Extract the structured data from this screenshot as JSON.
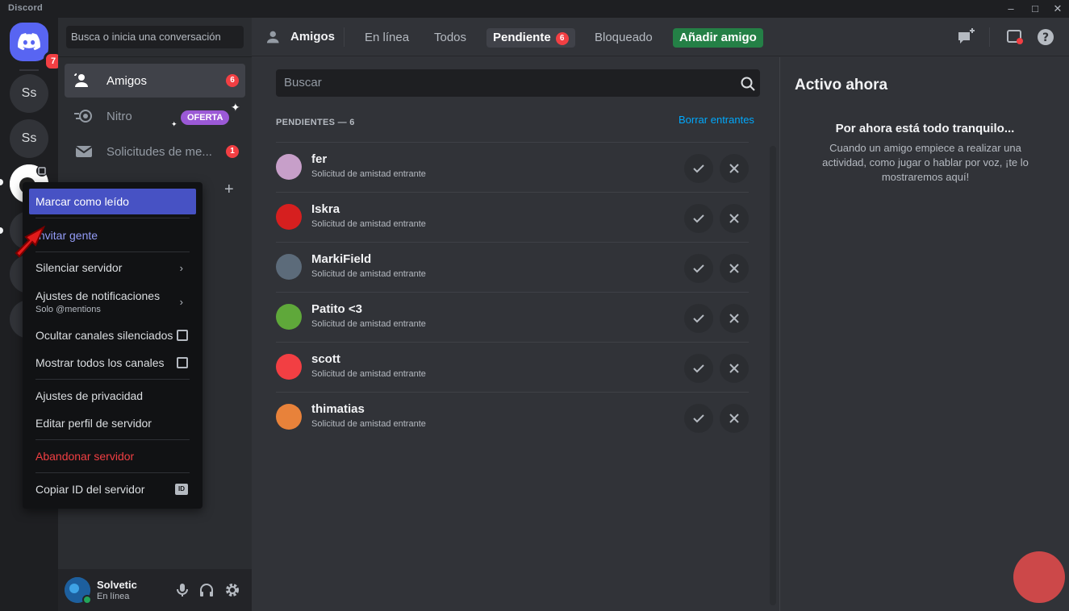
{
  "window": {
    "app_name": "Discord"
  },
  "guilds": {
    "home_badge": "7",
    "items": [
      {
        "label": "Ss"
      },
      {
        "label": "Ss"
      }
    ]
  },
  "sidebar": {
    "search_placeholder": "Busca o inicia una conversación",
    "nav": [
      {
        "label": "Amigos",
        "badge": "6"
      },
      {
        "label": "Nitro",
        "tag": "OFERTA"
      },
      {
        "label": "Solicitudes de me...",
        "badge": "1"
      }
    ],
    "add_dm_symbol": "+"
  },
  "user": {
    "name": "Solvetic",
    "status": "En línea"
  },
  "header": {
    "title": "Amigos",
    "tabs": [
      {
        "label": "En línea"
      },
      {
        "label": "Todos"
      },
      {
        "label": "Pendiente",
        "badge": "6"
      },
      {
        "label": "Bloqueado"
      }
    ],
    "add_friend": "Añadir amigo"
  },
  "friends": {
    "search_placeholder": "Buscar",
    "section_title": "PENDIENTES — 6",
    "clear_link": "Borrar entrantes",
    "rows": [
      {
        "name": "fer",
        "sub": "Solicitud de amistad entrante",
        "color": "#c79fc9"
      },
      {
        "name": "Iskra",
        "sub": "Solicitud de amistad entrante",
        "color": "#d61f1f"
      },
      {
        "name": "MarkiField",
        "sub": "Solicitud de amistad entrante",
        "color": "#5c6b7a"
      },
      {
        "name": "Patito <3",
        "sub": "Solicitud de amistad entrante",
        "color": "#5fa83a"
      },
      {
        "name": "scott",
        "sub": "Solicitud de amistad entrante",
        "color": "#f23f43"
      },
      {
        "name": "thimatias",
        "sub": "Solicitud de amistad entrante",
        "color": "#e8823a"
      }
    ]
  },
  "active_now": {
    "title": "Activo ahora",
    "heading": "Por ahora está todo tranquilo...",
    "text": "Cuando un amigo empiece a realizar una actividad, como jugar o hablar por voz, ¡te lo mostraremos aquí!"
  },
  "context_menu": {
    "mark_read": "Marcar como leído",
    "invite": "Invitar gente",
    "mute": "Silenciar servidor",
    "notif": "Ajustes de notificaciones",
    "notif_sub": "Solo @mentions",
    "hide_muted": "Ocultar canales silenciados",
    "show_all": "Mostrar todos los canales",
    "privacy": "Ajustes de privacidad",
    "edit_profile": "Editar perfil de servidor",
    "leave": "Abandonar servidor",
    "copy_id": "Copiar ID del servidor",
    "id_badge": "ID"
  },
  "colors": {
    "accent": "#5865f2",
    "danger": "#f23f43",
    "success": "#248046",
    "link": "#00a8fc"
  }
}
